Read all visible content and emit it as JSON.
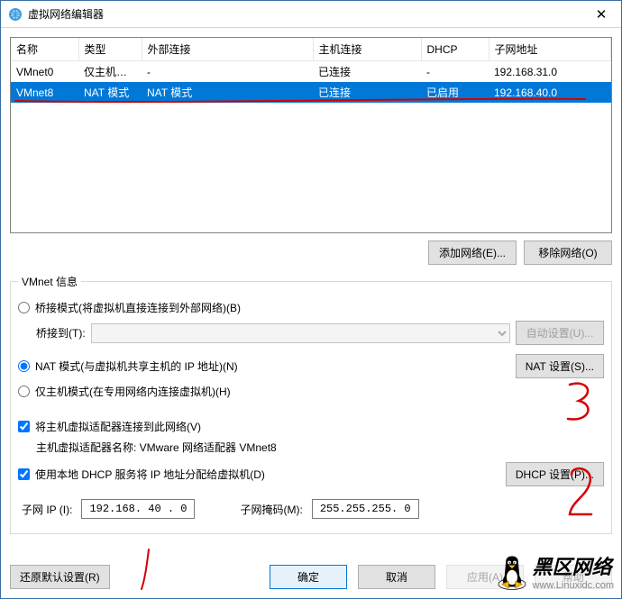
{
  "window": {
    "title": "虚拟网络编辑器",
    "close_label": "✕"
  },
  "table": {
    "headers": {
      "name": "名称",
      "type": "类型",
      "ext": "外部连接",
      "host": "主机连接",
      "dhcp": "DHCP",
      "subnet": "子网地址"
    },
    "rows": [
      {
        "name": "VMnet0",
        "type": "仅主机…",
        "ext": "-",
        "host": "已连接",
        "dhcp": "-",
        "subnet": "192.168.31.0"
      },
      {
        "name": "VMnet8",
        "type": "NAT 模式",
        "ext": "NAT 模式",
        "host": "已连接",
        "dhcp": "已启用",
        "subnet": "192.168.40.0"
      }
    ]
  },
  "buttons": {
    "add_network": "添加网络(E)...",
    "remove_network": "移除网络(O)",
    "auto_settings": "自动设置(U)...",
    "nat_settings": "NAT 设置(S)...",
    "dhcp_settings": "DHCP 设置(P)...",
    "restore": "还原默认设置(R)",
    "ok": "确定",
    "cancel": "取消",
    "apply": "应用(A)",
    "help": "帮助"
  },
  "fieldset": {
    "legend": "VMnet 信息",
    "radio_bridged": "桥接模式(将虚拟机直接连接到外部网络)(B)",
    "bridged_to": "桥接到(T):",
    "radio_nat": "NAT 模式(与虚拟机共享主机的 IP 地址)(N)",
    "radio_hostonly": "仅主机模式(在专用网络内连接虚拟机)(H)",
    "check_host_adapter": "将主机虚拟适配器连接到此网络(V)",
    "host_adapter_name": "主机虚拟适配器名称: VMware 网络适配器 VMnet8",
    "check_dhcp": "使用本地 DHCP 服务将 IP 地址分配给虚拟机(D)"
  },
  "ip": {
    "subnet_label": "子网 IP (I):",
    "subnet_value": "192.168. 40 . 0",
    "mask_label": "子网掩码(M):",
    "mask_value": "255.255.255. 0"
  },
  "annotations": {
    "a1": "1",
    "a2": "2",
    "a3": "3"
  },
  "watermark": {
    "main": "黑区网络",
    "sub": "www.Linuxidc.com"
  }
}
